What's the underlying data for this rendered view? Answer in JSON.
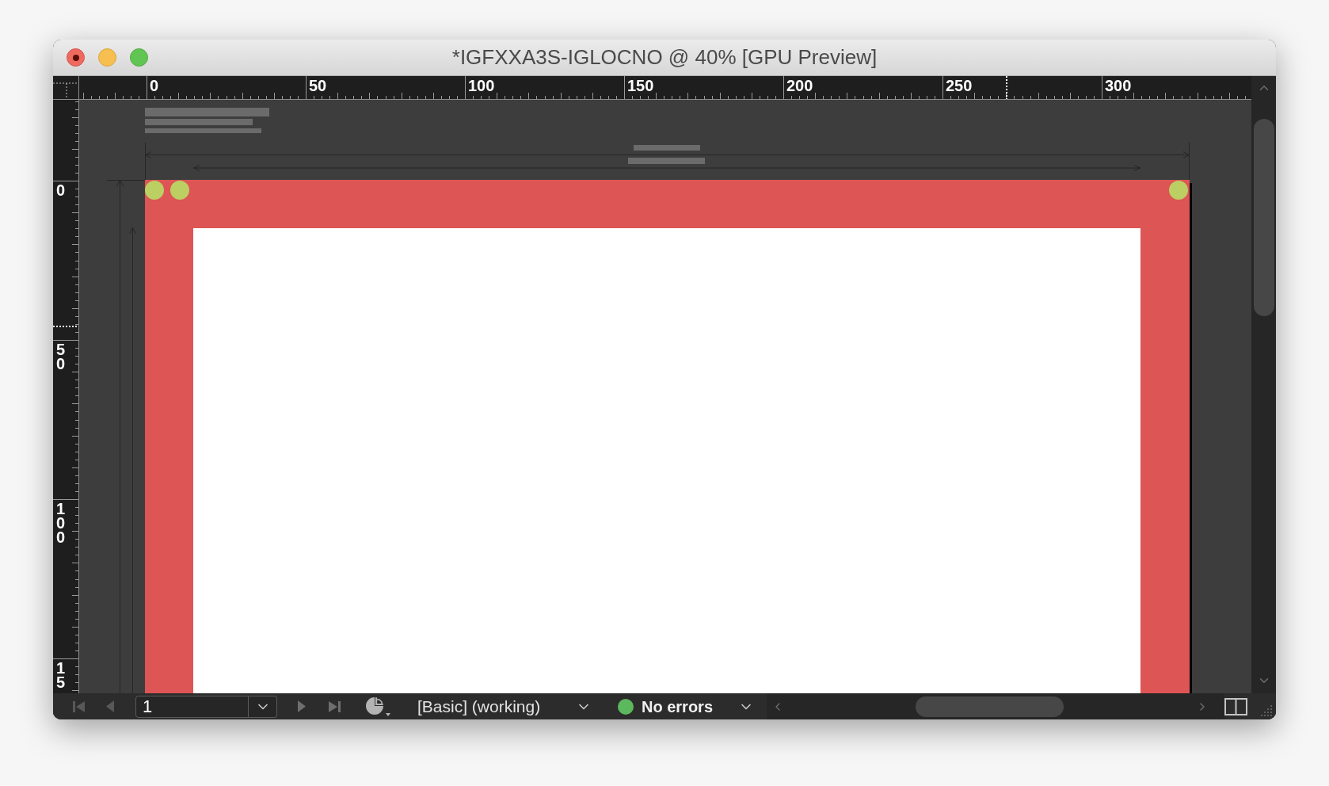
{
  "window": {
    "title": "*IGFXXA3S-IGLOCNO @ 40% [GPU Preview]"
  },
  "rulers": {
    "horizontal_labels": [
      "0",
      "50",
      "100",
      "150",
      "200",
      "250",
      "300"
    ],
    "vertical_labels": [
      "0",
      "50",
      "100",
      "15"
    ]
  },
  "status_bar": {
    "page_field": {
      "value": "1"
    },
    "profile": "[Basic] (working)",
    "preflight": {
      "label": "No errors",
      "ok": true
    }
  }
}
